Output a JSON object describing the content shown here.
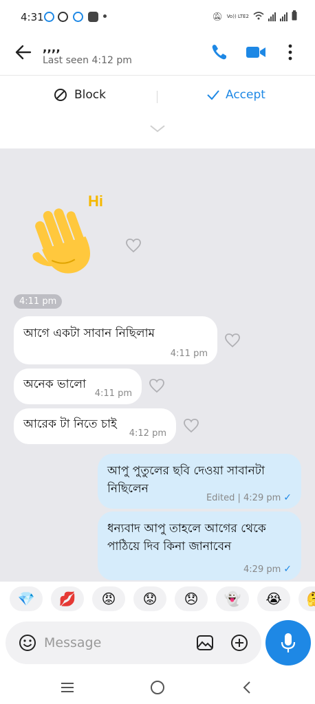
{
  "status": {
    "time": "4:31",
    "net_label": "Vo)) LTE2"
  },
  "header": {
    "title": ",,,,",
    "subtitle": "Last seen 4:12 pm"
  },
  "request": {
    "block_label": "Block",
    "accept_label": "Accept"
  },
  "sticker": {
    "text": "Hi"
  },
  "date_pill": "4:11 pm",
  "messages": [
    {
      "text": "আগে একটা সাবান নিছিলাম",
      "time": "4:11 pm"
    },
    {
      "text": "অনেক ভালো",
      "time": "4:11 pm"
    },
    {
      "text": "আরেক টা নিতে চাই",
      "time": "4:12 pm"
    },
    {
      "text": "আপু পুতুলের ছবি দেওয়া সাবানটা নিছিলেন",
      "time": "Edited | 4:29 pm"
    },
    {
      "text": "ধন্যবাদ আপু তাহলে আগের থেকে পাঠিয়ে দিব কিনা জানাবেন",
      "time": "4:29 pm"
    }
  ],
  "reactions": [
    "💎",
    "💋",
    "😡",
    "😟",
    "😞",
    "👻",
    "😭",
    "🤔"
  ],
  "composer": {
    "placeholder": "Message"
  },
  "colors": {
    "accent": "#1e88e5",
    "outgoing": "#d6ecfb",
    "chat_bg": "#e8e8ec"
  }
}
